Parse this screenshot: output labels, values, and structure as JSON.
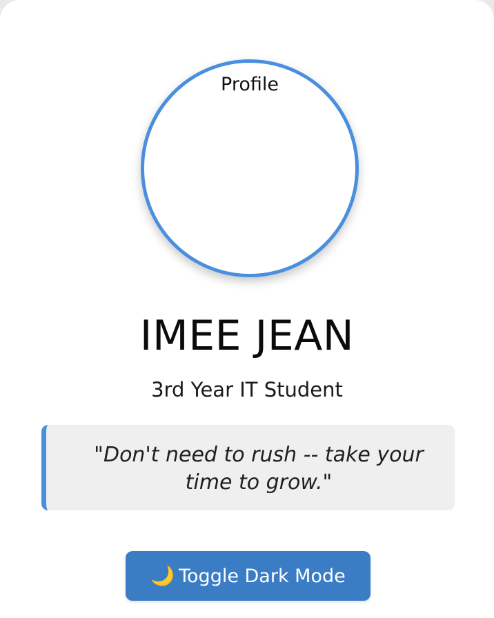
{
  "profile": {
    "avatar_alt": "Profile",
    "name": "IMEE JEAN",
    "subtitle": "3rd Year IT Student",
    "quote": "\"Don't need to rush -- take your time to grow.\""
  },
  "toggle": {
    "icon": "moon-icon",
    "icon_glyph": "🌙",
    "label": "Toggle Dark Mode"
  },
  "colors": {
    "accent": "#4a8fdf",
    "button_bg": "#3b7dc4",
    "quote_bg": "#efefef"
  }
}
